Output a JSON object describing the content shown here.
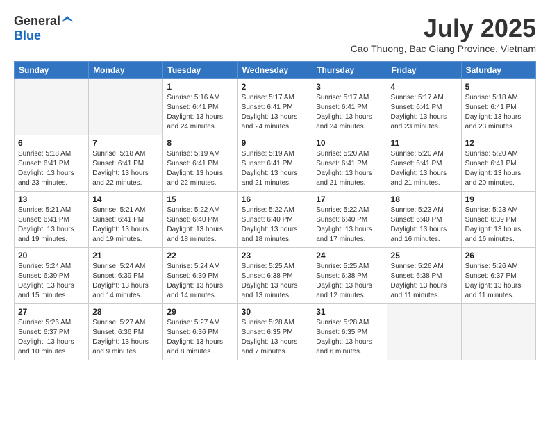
{
  "header": {
    "logo_general": "General",
    "logo_blue": "Blue",
    "month_title": "July 2025",
    "location": "Cao Thuong, Bac Giang Province, Vietnam"
  },
  "days_of_week": [
    "Sunday",
    "Monday",
    "Tuesday",
    "Wednesday",
    "Thursday",
    "Friday",
    "Saturday"
  ],
  "weeks": [
    [
      {
        "day": "",
        "info": ""
      },
      {
        "day": "",
        "info": ""
      },
      {
        "day": "1",
        "info": "Sunrise: 5:16 AM\nSunset: 6:41 PM\nDaylight: 13 hours and 24 minutes."
      },
      {
        "day": "2",
        "info": "Sunrise: 5:17 AM\nSunset: 6:41 PM\nDaylight: 13 hours and 24 minutes."
      },
      {
        "day": "3",
        "info": "Sunrise: 5:17 AM\nSunset: 6:41 PM\nDaylight: 13 hours and 24 minutes."
      },
      {
        "day": "4",
        "info": "Sunrise: 5:17 AM\nSunset: 6:41 PM\nDaylight: 13 hours and 23 minutes."
      },
      {
        "day": "5",
        "info": "Sunrise: 5:18 AM\nSunset: 6:41 PM\nDaylight: 13 hours and 23 minutes."
      }
    ],
    [
      {
        "day": "6",
        "info": "Sunrise: 5:18 AM\nSunset: 6:41 PM\nDaylight: 13 hours and 23 minutes."
      },
      {
        "day": "7",
        "info": "Sunrise: 5:18 AM\nSunset: 6:41 PM\nDaylight: 13 hours and 22 minutes."
      },
      {
        "day": "8",
        "info": "Sunrise: 5:19 AM\nSunset: 6:41 PM\nDaylight: 13 hours and 22 minutes."
      },
      {
        "day": "9",
        "info": "Sunrise: 5:19 AM\nSunset: 6:41 PM\nDaylight: 13 hours and 21 minutes."
      },
      {
        "day": "10",
        "info": "Sunrise: 5:20 AM\nSunset: 6:41 PM\nDaylight: 13 hours and 21 minutes."
      },
      {
        "day": "11",
        "info": "Sunrise: 5:20 AM\nSunset: 6:41 PM\nDaylight: 13 hours and 21 minutes."
      },
      {
        "day": "12",
        "info": "Sunrise: 5:20 AM\nSunset: 6:41 PM\nDaylight: 13 hours and 20 minutes."
      }
    ],
    [
      {
        "day": "13",
        "info": "Sunrise: 5:21 AM\nSunset: 6:41 PM\nDaylight: 13 hours and 19 minutes."
      },
      {
        "day": "14",
        "info": "Sunrise: 5:21 AM\nSunset: 6:41 PM\nDaylight: 13 hours and 19 minutes."
      },
      {
        "day": "15",
        "info": "Sunrise: 5:22 AM\nSunset: 6:40 PM\nDaylight: 13 hours and 18 minutes."
      },
      {
        "day": "16",
        "info": "Sunrise: 5:22 AM\nSunset: 6:40 PM\nDaylight: 13 hours and 18 minutes."
      },
      {
        "day": "17",
        "info": "Sunrise: 5:22 AM\nSunset: 6:40 PM\nDaylight: 13 hours and 17 minutes."
      },
      {
        "day": "18",
        "info": "Sunrise: 5:23 AM\nSunset: 6:40 PM\nDaylight: 13 hours and 16 minutes."
      },
      {
        "day": "19",
        "info": "Sunrise: 5:23 AM\nSunset: 6:39 PM\nDaylight: 13 hours and 16 minutes."
      }
    ],
    [
      {
        "day": "20",
        "info": "Sunrise: 5:24 AM\nSunset: 6:39 PM\nDaylight: 13 hours and 15 minutes."
      },
      {
        "day": "21",
        "info": "Sunrise: 5:24 AM\nSunset: 6:39 PM\nDaylight: 13 hours and 14 minutes."
      },
      {
        "day": "22",
        "info": "Sunrise: 5:24 AM\nSunset: 6:39 PM\nDaylight: 13 hours and 14 minutes."
      },
      {
        "day": "23",
        "info": "Sunrise: 5:25 AM\nSunset: 6:38 PM\nDaylight: 13 hours and 13 minutes."
      },
      {
        "day": "24",
        "info": "Sunrise: 5:25 AM\nSunset: 6:38 PM\nDaylight: 13 hours and 12 minutes."
      },
      {
        "day": "25",
        "info": "Sunrise: 5:26 AM\nSunset: 6:38 PM\nDaylight: 13 hours and 11 minutes."
      },
      {
        "day": "26",
        "info": "Sunrise: 5:26 AM\nSunset: 6:37 PM\nDaylight: 13 hours and 11 minutes."
      }
    ],
    [
      {
        "day": "27",
        "info": "Sunrise: 5:26 AM\nSunset: 6:37 PM\nDaylight: 13 hours and 10 minutes."
      },
      {
        "day": "28",
        "info": "Sunrise: 5:27 AM\nSunset: 6:36 PM\nDaylight: 13 hours and 9 minutes."
      },
      {
        "day": "29",
        "info": "Sunrise: 5:27 AM\nSunset: 6:36 PM\nDaylight: 13 hours and 8 minutes."
      },
      {
        "day": "30",
        "info": "Sunrise: 5:28 AM\nSunset: 6:35 PM\nDaylight: 13 hours and 7 minutes."
      },
      {
        "day": "31",
        "info": "Sunrise: 5:28 AM\nSunset: 6:35 PM\nDaylight: 13 hours and 6 minutes."
      },
      {
        "day": "",
        "info": ""
      },
      {
        "day": "",
        "info": ""
      }
    ]
  ]
}
